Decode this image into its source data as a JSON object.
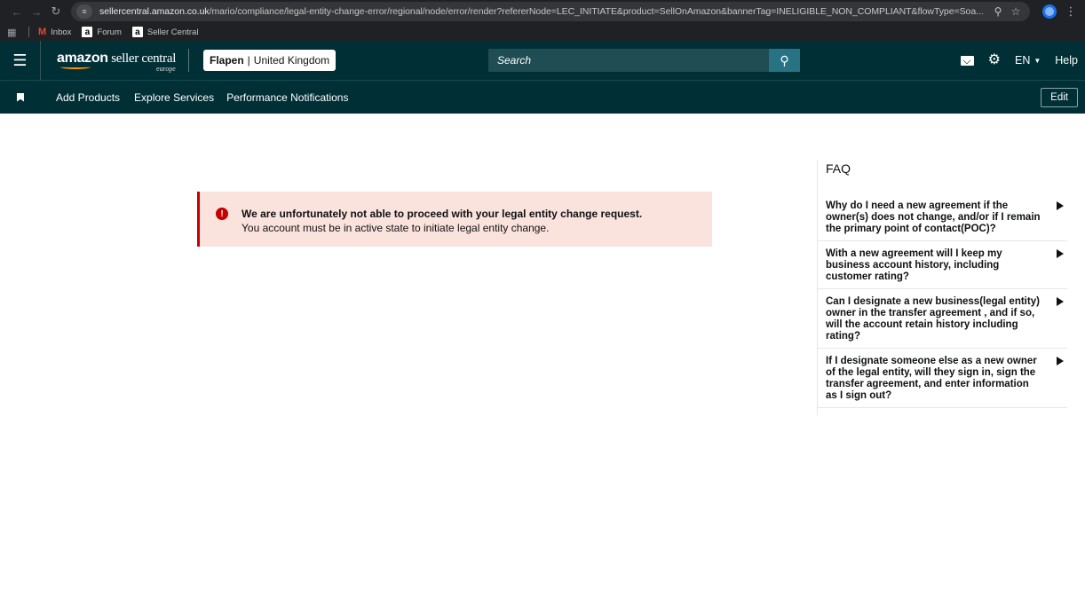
{
  "browser": {
    "url_host": "sellercentral.amazon.co.uk",
    "url_path": "/mario/compliance/legal-entity-change-error/regional/node/error/render?refererNode=LEC_INITIATE&product=SellOnAmazon&bannerTag=INELIGIBLE_NON_COMPLIANT&flowType=Soa...",
    "bookmarks": [
      {
        "label": "Inbox",
        "icon": "gmail-icon"
      },
      {
        "label": "Forum",
        "icon": "amazon-icon"
      },
      {
        "label": "Seller Central",
        "icon": "amazon-icon"
      }
    ]
  },
  "header": {
    "logo_bold": "amazon",
    "logo_rest": " seller central",
    "logo_region": "europe",
    "account_name": "Flapen",
    "account_separator": "|",
    "account_region": "United Kingdom",
    "search_placeholder": "Search",
    "language": "EN",
    "help": "Help"
  },
  "nav": {
    "items": [
      "Add Products",
      "Explore Services",
      "Performance Notifications"
    ],
    "edit": "Edit"
  },
  "alert": {
    "title": "We are unfortunately not able to proceed with your legal entity change request.",
    "body": "You account must be in active state to initiate legal entity change."
  },
  "faq": {
    "title": "FAQ",
    "items": [
      "Why do I need a new agreement if the owner(s) does not change, and/or if I remain the primary point of contact(POC)?",
      "With a new agreement will I keep my business account history, including customer rating?",
      "Can I designate a new business(legal entity) owner in the transfer agreement , and if so, will the account retain history including rating?",
      "If I designate someone else as a new owner of the legal entity, will they sign in, sign the transfer agreement, and enter information as I sign out?"
    ]
  },
  "colors": {
    "header_bg": "#002f36",
    "search_btn": "#277383",
    "alert_bg": "#fbe3dd",
    "alert_accent": "#c40000"
  }
}
